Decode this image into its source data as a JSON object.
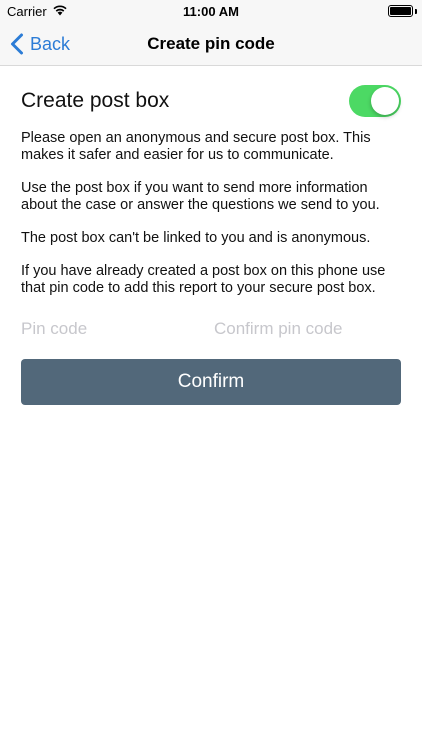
{
  "status_bar": {
    "carrier": "Carrier",
    "time": "11:00 AM",
    "icons": [
      "wifi-icon",
      "battery-icon"
    ]
  },
  "nav": {
    "back_label": "Back",
    "back_icon": "chevron-left-icon",
    "title": "Create pin code"
  },
  "form": {
    "heading": "Create post box",
    "toggle_on": true,
    "paragraphs": [
      "Please open an anonymous and secure post box. This makes it safer and easier for us to communicate.",
      "Use the post box if you want to send more information about the case or answer the questions we send to you.",
      "The post box can't be linked to you and is anonymous.",
      "If you have already created a post box on this phone use that pin code to add this report to your secure post box."
    ],
    "pin_placeholder": "Pin code",
    "confirm_pin_placeholder": "Confirm pin code",
    "pin_value": "",
    "confirm_pin_value": "",
    "confirm_label": "Confirm"
  },
  "colors": {
    "accent": "#2c7cd6",
    "toggle_on": "#4cd964",
    "button": "#52687a"
  }
}
